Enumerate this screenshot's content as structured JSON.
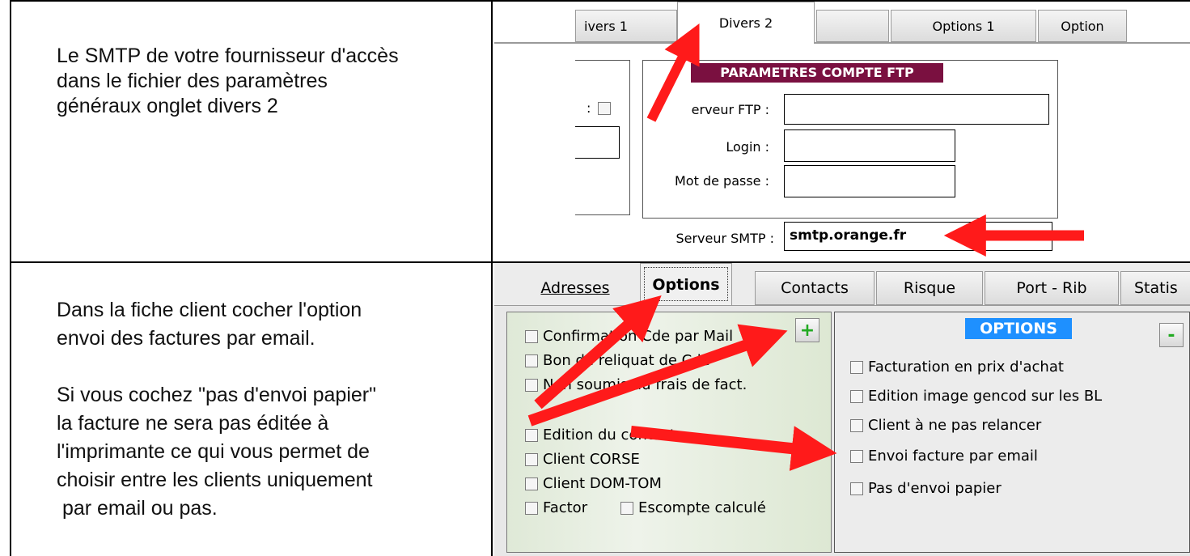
{
  "row1": {
    "description": [
      "Le SMTP de votre fournisseur d'accès",
      "dans le fichier des paramètres",
      "généraux onglet divers 2"
    ],
    "tabs": [
      "ivers 1",
      "Divers 2",
      "",
      "Options 1",
      "Option"
    ],
    "group_title": "PARAMETRES COMPTE FTP",
    "left_stub_label": ":",
    "fields": {
      "ftp_label": "erveur FTP :",
      "login_label": "Login :",
      "password_label": "Mot de passe :",
      "smtp_label": "Serveur SMTP :",
      "smtp_value": "smtp.orange.fr"
    }
  },
  "row2": {
    "description": [
      "Dans la fiche client cocher l'option",
      "envoi des factures par email.",
      "",
      "Si vous cochez \"pas d'envoi papier\"",
      "la facture ne sera pas éditée à",
      "l'imprimante ce qui vous permet de",
      "choisir entre les clients uniquement",
      " par email ou pas."
    ],
    "tabs": [
      "Adresses",
      "Options",
      "Contacts",
      "Risque",
      "Port - Rib",
      "Statis"
    ],
    "left_options": [
      "Confirmation Cde par Mail",
      "Bon de reliquat de Cde",
      "Non soumis au frais de fact.",
      "Edition du contact",
      "Client CORSE",
      "Client DOM-TOM",
      "Factor",
      "Escompte calculé"
    ],
    "right_title": "OPTIONS",
    "right_options": [
      "Facturation en prix d'achat",
      "Edition image gencod sur les BL",
      "Client à ne pas relancer",
      "Envoi facture par email",
      "Pas d'envoi papier"
    ],
    "plus_label": "+",
    "minus_label": "-"
  },
  "colors": {
    "arrow": "#ff1a1a",
    "group_title_bg": "#7a1040",
    "options_title_bg": "#1e90ff",
    "plus_green": "#22aa22"
  }
}
